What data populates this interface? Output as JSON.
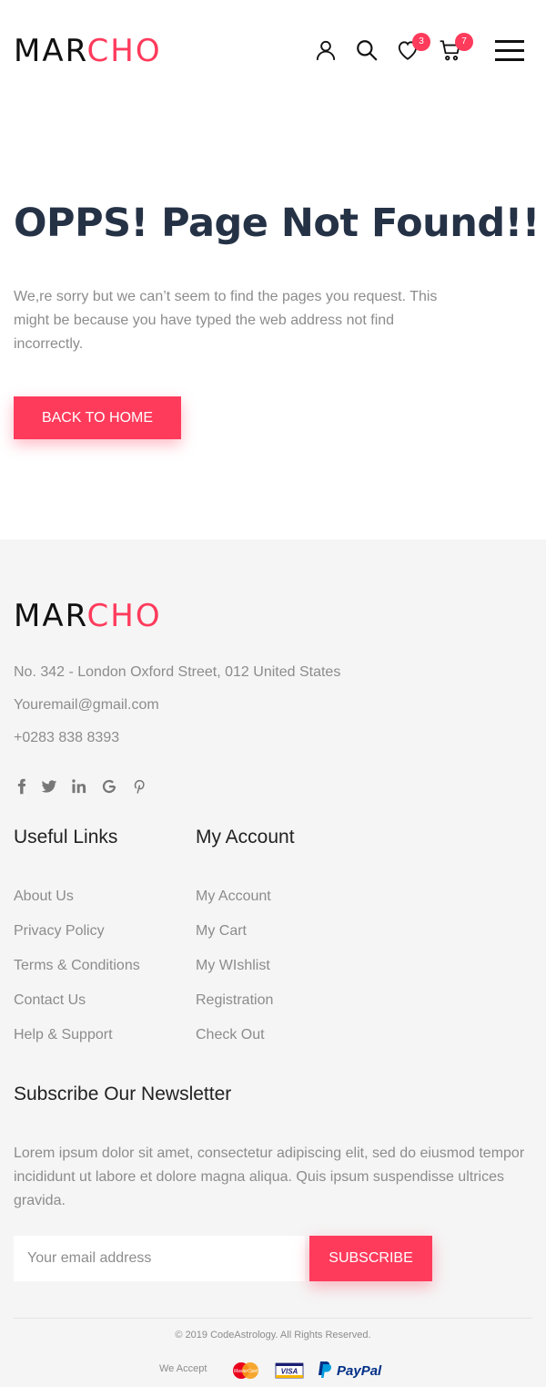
{
  "header": {
    "logo_part1": "MAR",
    "logo_part2": "CHO",
    "wishlist_count": "3",
    "cart_count": "7"
  },
  "error": {
    "title": "OPPS! Page Not Found!!",
    "message": "We,re sorry but we can’t seem to find the pages you request. This might be because you have typed the web address not find incorrectly.",
    "button_label": "BACK TO HOME"
  },
  "footer": {
    "logo_part1": "MAR",
    "logo_part2": "CHO",
    "address": "No. 342 - London Oxford Street, 012 United States",
    "email": "Youremail@gmail.com",
    "phone": "+0283 838 8393",
    "socials": [
      "facebook-icon",
      "twitter-icon",
      "linkedin-icon",
      "google-icon",
      "pinterest-icon"
    ],
    "useful_links": {
      "title": "Useful Links",
      "items": [
        "About Us",
        "Privacy Policy",
        "Terms & Conditions",
        "Contact Us",
        "Help & Support"
      ]
    },
    "my_account": {
      "title": "My Account",
      "items": [
        "My Account",
        "My Cart",
        "My WIshlist",
        "Registration",
        "Check Out"
      ]
    },
    "newsletter": {
      "title": "Subscribe Our Newsletter",
      "text": "Lorem ipsum dolor sit amet, consectetur adipiscing elit, sed do eiusmod tempor incididunt ut labore et dolore magna aliqua. Quis ipsum suspendisse ultrices gravida.",
      "placeholder": "Your email address",
      "button_label": "SUBSCRIBE"
    },
    "copyright": "© 2019 CodeAstrology. All Rights Reserved.",
    "we_accept": "We Accept",
    "payment_methods": [
      "mastercard-icon",
      "visa-icon",
      "paypal-icon"
    ],
    "paypal_text": "PayPal",
    "visa_text": "VISA",
    "mastercard_text": "MasterCard"
  },
  "colors": {
    "accent": "#ff3b5c",
    "title": "#253246",
    "muted": "#8c8c8c",
    "footer_bg": "#f5f5f5"
  }
}
